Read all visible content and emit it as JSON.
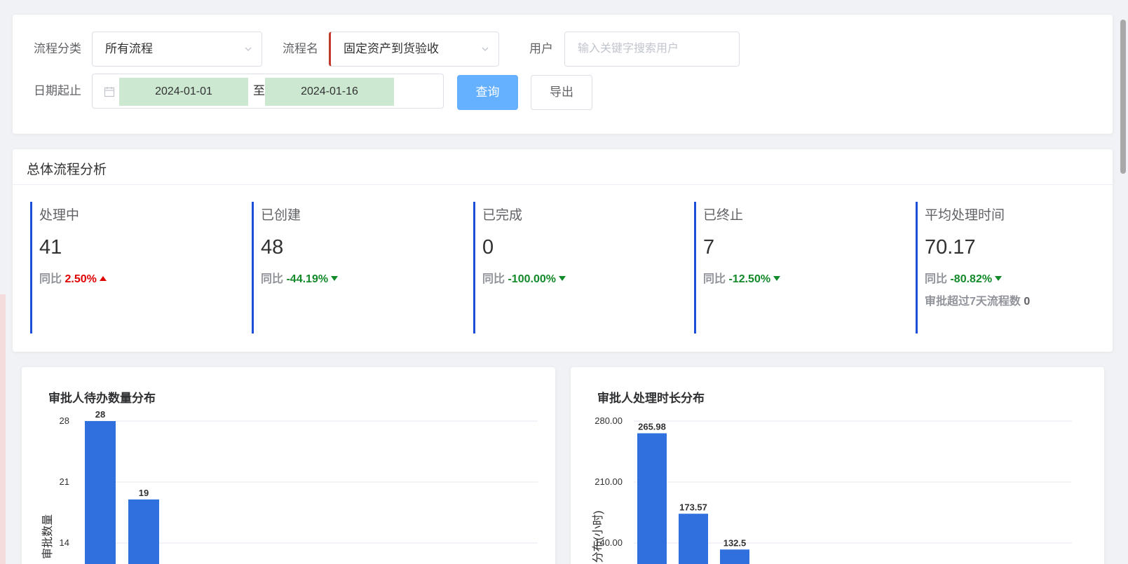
{
  "filters": {
    "category_label": "流程分类",
    "category_value": "所有流程",
    "process_label": "流程名",
    "process_value": "固定资产到货验收",
    "user_label": "用户",
    "user_placeholder": "输入关键字搜索用户",
    "date_label": "日期起止",
    "date_start": "2024-01-01",
    "date_sep": "至",
    "date_end": "2024-01-16",
    "query_button": "查询",
    "export_button": "导出"
  },
  "summary": {
    "title": "总体流程分析",
    "yoy_label": "同比",
    "stats": [
      {
        "label": "处理中",
        "value": "41",
        "yoy": "2.50%",
        "trend": "up"
      },
      {
        "label": "已创建",
        "value": "48",
        "yoy": "-44.19%",
        "trend": "down"
      },
      {
        "label": "已完成",
        "value": "0",
        "yoy": "-100.00%",
        "trend": "down"
      },
      {
        "label": "已终止",
        "value": "7",
        "yoy": "-12.50%",
        "trend": "down"
      },
      {
        "label": "平均处理时间",
        "value": "70.17",
        "yoy": "-80.82%",
        "trend": "down"
      }
    ],
    "extra_label": "审批超过7天流程数",
    "extra_value": "0"
  },
  "colors": {
    "accent": "#1d4fd8",
    "bar": "#2f6fde",
    "up": "#e00000",
    "down": "#138a2a",
    "primary_button": "#66b1ff"
  },
  "chart_data": [
    {
      "type": "bar",
      "title": "审批人待办数量分布",
      "ylabel": "审批数量",
      "yticks": [
        "28",
        "21",
        "14"
      ],
      "ylim": [
        0,
        28
      ],
      "values": [
        28,
        19
      ],
      "value_labels": [
        "28",
        "19"
      ],
      "grid": true
    },
    {
      "type": "bar",
      "title": "审批人处理时长分布",
      "ylabel": "分布(小时)",
      "yticks": [
        "280.00",
        "210.00",
        "140.00"
      ],
      "ylim": [
        0,
        280
      ],
      "values": [
        265.98,
        173.57,
        132.5
      ],
      "value_labels": [
        "265.98",
        "173.57",
        "132.5"
      ],
      "grid": true
    }
  ]
}
